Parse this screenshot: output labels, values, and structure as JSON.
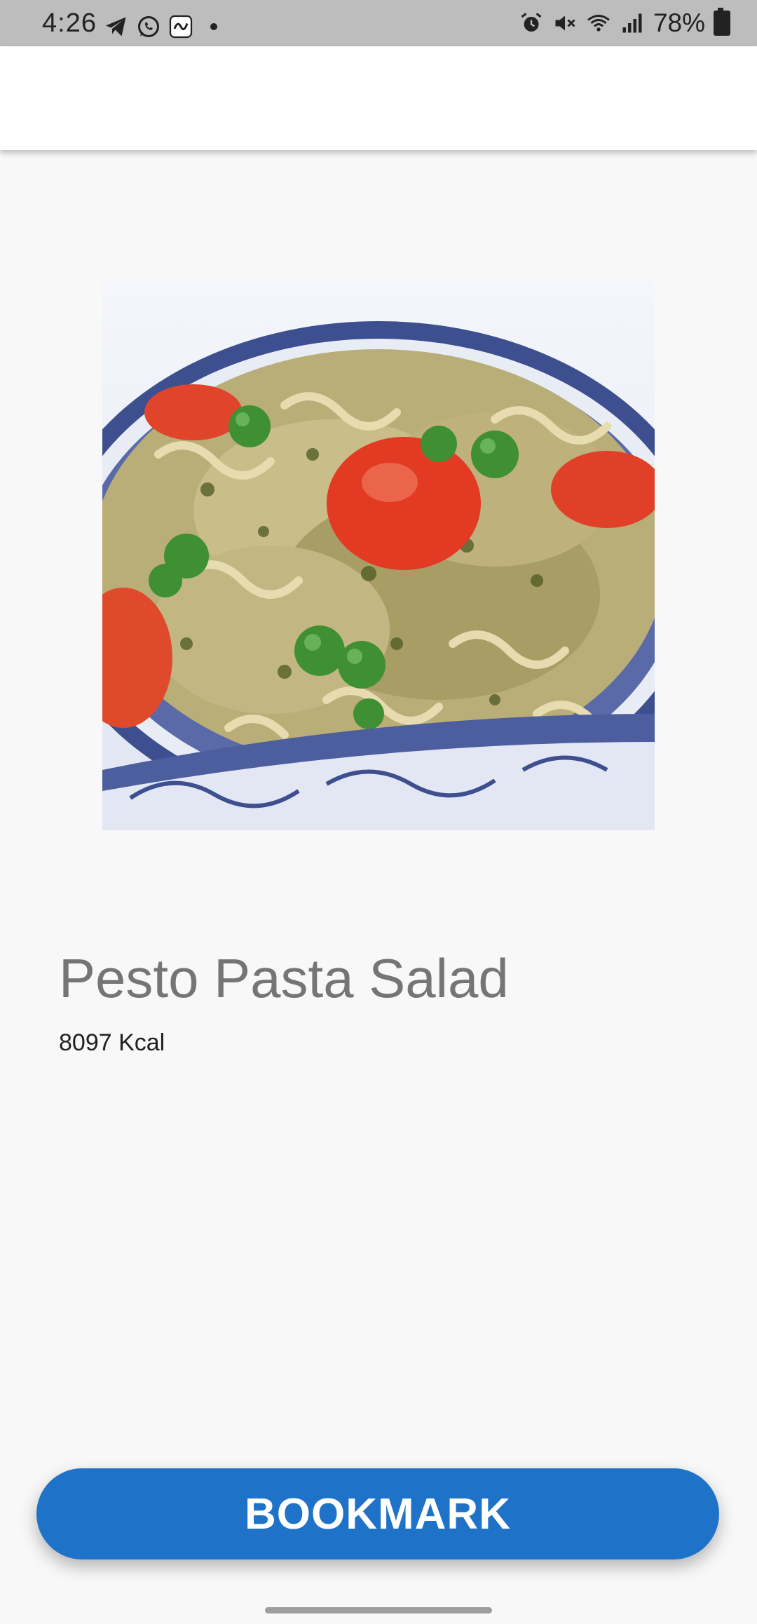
{
  "status_bar": {
    "time": "4:26",
    "left_icons": [
      "telegram-icon",
      "whatsapp-icon",
      "app-notification-icon"
    ],
    "right_icons": [
      "alarm-icon",
      "mute-icon",
      "wifi-icon",
      "signal-icon",
      "battery-icon"
    ],
    "battery_percent": "78%"
  },
  "recipe": {
    "image_description": "plate of pesto pasta with tomatoes and peas",
    "title": "Pesto Pasta Salad",
    "kcal": "8097 Kcal"
  },
  "actions": {
    "bookmark_label": "BOOKMARK"
  },
  "colors": {
    "accent": "#1e73c8",
    "status_bar": "#bdbdbd",
    "background": "#f8f8f8",
    "title_text": "#757575"
  }
}
